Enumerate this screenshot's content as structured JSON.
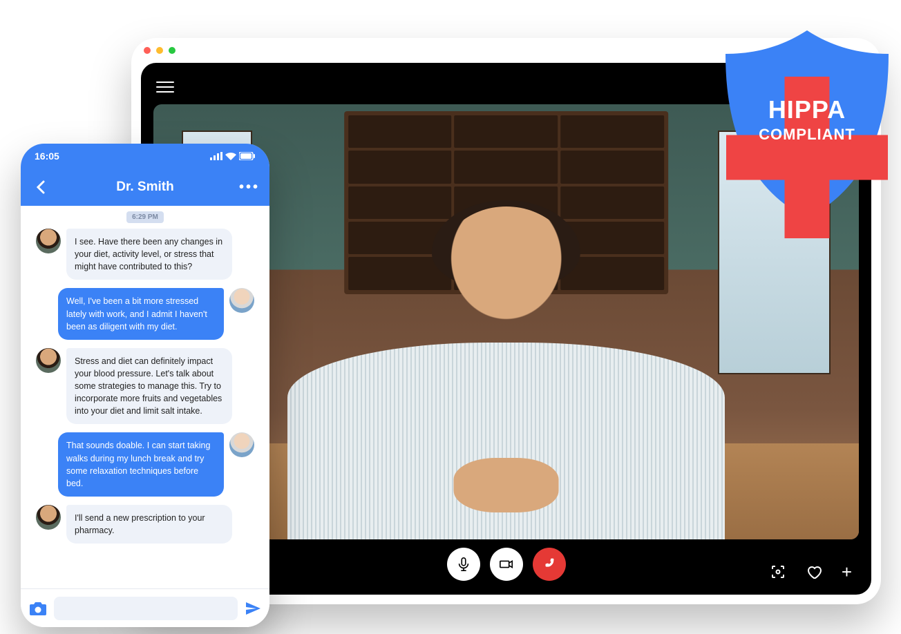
{
  "colors": {
    "primary_blue": "#3b82f6",
    "hangup_red": "#e53935",
    "titlebar_red": "#ff5f57",
    "titlebar_yellow": "#febc2e",
    "titlebar_green": "#28c840",
    "plus_red": "#ef4444"
  },
  "tablet": {
    "titlebar": {
      "dots": [
        "red",
        "yellow",
        "green"
      ]
    }
  },
  "chat": {
    "status_time": "16:05",
    "title": "Dr. Smith",
    "timestamp": "6:29 PM",
    "messages": [
      {
        "side": "incoming",
        "avatar": "doctor",
        "text": "I see. Have there been any changes in your diet, activity level, or stress that might have contributed to this?"
      },
      {
        "side": "outgoing",
        "avatar": "patient",
        "text": "Well, I've been a bit more stressed lately with work, and I admit I haven't been as diligent with my diet."
      },
      {
        "side": "incoming",
        "avatar": "doctor",
        "text": "Stress and diet can definitely impact your blood pressure. Let's talk about some strategies to manage this. Try to incorporate more fruits and vegetables into your diet and limit salt intake."
      },
      {
        "side": "outgoing",
        "avatar": "patient",
        "text": "That sounds doable. I can start taking walks during my lunch break and try some relaxation techniques before bed."
      },
      {
        "side": "incoming",
        "avatar": "doctor",
        "text": "I'll send a new prescription to your pharmacy."
      }
    ]
  },
  "badge": {
    "line1": "HIPPA",
    "line2": "COMPLIANT"
  }
}
